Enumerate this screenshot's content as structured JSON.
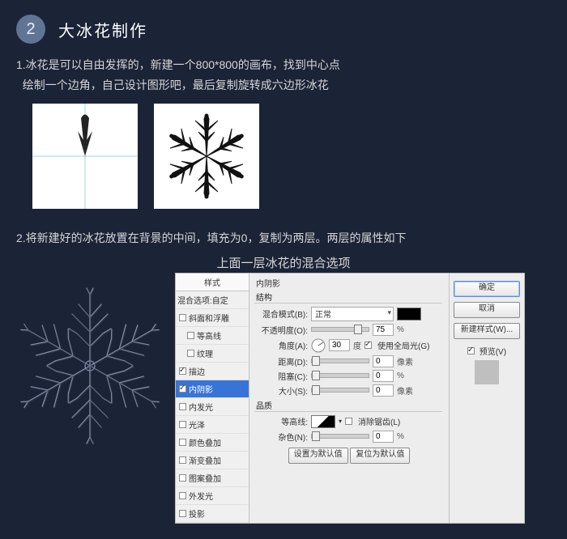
{
  "step": {
    "number": "2",
    "title": "大冰花制作"
  },
  "text1_line1": "1.冰花是可以自由发挥的，新建一个800*800的画布，找到中心点",
  "text1_line2": "绘制一个边角，自己设计图形吧，最后复制旋转成六边形冰花",
  "text2": "2.将新建好的冰花放置在背景的中间，填充为0，复制为两层。两层的属性如下",
  "caption": "上面一层冰花的混合选项",
  "dialog": {
    "left_title": "样式",
    "left_items": [
      {
        "label": "混合选项:自定",
        "checked": null
      },
      {
        "label": "斜面和浮雕",
        "checked": false
      },
      {
        "label": "等高线",
        "checked": false
      },
      {
        "label": "纹理",
        "checked": false
      },
      {
        "label": "描边",
        "checked": true
      },
      {
        "label": "内阴影",
        "checked": true,
        "selected": true
      },
      {
        "label": "内发光",
        "checked": false
      },
      {
        "label": "光泽",
        "checked": false
      },
      {
        "label": "颜色叠加",
        "checked": false
      },
      {
        "label": "渐变叠加",
        "checked": false
      },
      {
        "label": "图案叠加",
        "checked": false
      },
      {
        "label": "外发光",
        "checked": false
      },
      {
        "label": "投影",
        "checked": false
      }
    ],
    "panel_title": "内阴影",
    "group_structure": "结构",
    "blend_mode_label": "混合模式(B):",
    "blend_mode_value": "正常",
    "opacity_label": "不透明度(O):",
    "opacity_value": "75",
    "angle_label": "角度(A):",
    "angle_value": "30",
    "angle_unit": "度",
    "use_global": "使用全局光(G)",
    "distance_label": "距离(D):",
    "distance_value": "0",
    "distance_unit": "像素",
    "choke_label": "阻塞(C):",
    "choke_value": "0",
    "size_label": "大小(S):",
    "size_value": "0",
    "size_unit": "像素",
    "group_quality": "品质",
    "contour_label": "等高线:",
    "antialias": "消除锯齿(L)",
    "noise_label": "杂色(N):",
    "noise_value": "0",
    "bottom_defaults": "设置为默认值",
    "bottom_reset": "复位为默认值",
    "right": {
      "ok": "确定",
      "cancel": "取消",
      "new_style": "新建样式(W)...",
      "preview": "预览(V)"
    }
  },
  "chart_data": {
    "type": "table",
    "title": "Inner Shadow layer-style settings (upper snowflake layer)",
    "rows": [
      {
        "param": "混合模式",
        "value": "正常"
      },
      {
        "param": "不透明度",
        "value": 75,
        "unit": "%"
      },
      {
        "param": "角度",
        "value": 30,
        "unit": "度",
        "use_global_light": true
      },
      {
        "param": "距离",
        "value": 0,
        "unit": "像素"
      },
      {
        "param": "阻塞",
        "value": 0,
        "unit": "%"
      },
      {
        "param": "大小",
        "value": 0,
        "unit": "像素"
      },
      {
        "param": "杂色",
        "value": 0,
        "unit": "%"
      }
    ]
  }
}
